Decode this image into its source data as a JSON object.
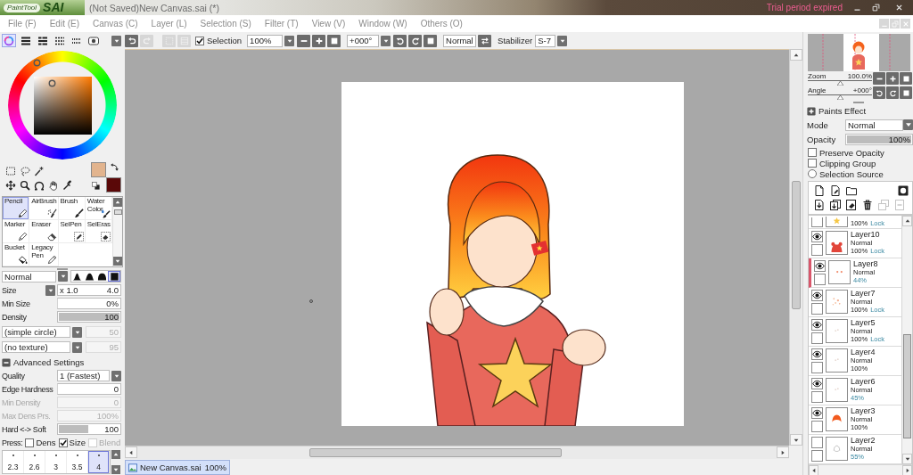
{
  "title_bar": {
    "logo_script": "PaintTool",
    "logo_mark": "SAI",
    "title": "(Not Saved)New Canvas.sai (*)",
    "notice": "Trial period expired"
  },
  "menu": [
    "File (F)",
    "Edit (E)",
    "Canvas (C)",
    "Layer (L)",
    "Selection (S)",
    "Filter (T)",
    "View (V)",
    "Window (W)",
    "Others (O)"
  ],
  "color_modes": [
    {
      "kind": "wheel",
      "selected": true
    },
    {
      "kind": "rgb",
      "selected": false
    },
    {
      "kind": "hsv",
      "selected": false
    },
    {
      "kind": "mixer",
      "selected": false
    },
    {
      "kind": "swatches",
      "selected": false
    },
    {
      "kind": "scratchpad",
      "selected": false
    }
  ],
  "colors": [
    {
      "kind": "primary",
      "color": "#e2b48e"
    },
    {
      "kind": "secondary",
      "color": "#5a0808"
    }
  ],
  "toolbar": {
    "buttons": [
      {
        "kind": "undo",
        "disabled": false
      },
      {
        "kind": "redo",
        "disabled": true
      },
      {
        "kind": "deselect",
        "disabled": true
      },
      {
        "kind": "invert",
        "disabled": true
      }
    ],
    "selection": {
      "label": "Selection",
      "checked": true
    },
    "zoom": "100%",
    "angle": "+000°",
    "blend": "Normal",
    "stabilizer": {
      "label": "Stabilizer",
      "value": "S-7"
    }
  },
  "tools": [
    {
      "kind": "pencil",
      "label": "Pencil",
      "selected": true
    },
    {
      "kind": "airbrush",
      "label": "AirBrush",
      "selected": false
    },
    {
      "kind": "brush",
      "label": "Brush",
      "selected": false
    },
    {
      "kind": "watercolor",
      "label": "Water Color",
      "selected": false
    },
    {
      "kind": "marker",
      "label": "Marker",
      "selected": false
    },
    {
      "kind": "eraser",
      "label": "Eraser",
      "selected": false
    },
    {
      "kind": "selpen",
      "label": "SelPen",
      "selected": false
    },
    {
      "kind": "seleras",
      "label": "SelEras",
      "selected": false
    },
    {
      "kind": "bucket",
      "label": "Bucket",
      "selected": false
    },
    {
      "kind": "legacypen",
      "label": "Legacy Pen",
      "selected": false
    }
  ],
  "brush": {
    "blend": "Normal",
    "shapes": [
      {
        "kind": "soft",
        "selected": false
      },
      {
        "kind": "medium",
        "selected": false
      },
      {
        "kind": "hard",
        "selected": false
      },
      {
        "kind": "square",
        "selected": true
      }
    ],
    "rows": [
      {
        "kind": "multiplier",
        "label": "Size",
        "factor": "x 1.0",
        "value": "4.0",
        "disabled": false
      },
      {
        "kind": "field",
        "label": "Min Size",
        "value": "0%",
        "disabled": false
      },
      {
        "kind": "bar",
        "label": "Density",
        "value": "100",
        "level": 1,
        "disabled": false
      },
      {
        "kind": "pair",
        "value": "(simple circle)",
        "amount": "50",
        "disabled": true
      },
      {
        "kind": "pair",
        "value": "(no texture)",
        "amount": "95",
        "disabled": true
      }
    ],
    "advanced": {
      "label": "Advanced Settings",
      "expanded": true,
      "rows": [
        {
          "kind": "dropdown",
          "label": "Quality",
          "value": "1 (Fastest)",
          "disabled": false
        },
        {
          "kind": "field",
          "label": "Edge Hardness",
          "value": "0",
          "disabled": false
        },
        {
          "kind": "field",
          "label": "Min Density",
          "value": "0",
          "disabled": true
        },
        {
          "kind": "field",
          "label": "Max Dens Prs.",
          "value": "100%",
          "disabled": true
        },
        {
          "kind": "bar",
          "label": "Hard <-> Soft",
          "value": "100",
          "level": 0.49,
          "disabled": false
        }
      ]
    },
    "pressure": {
      "label": "Press:",
      "options": [
        {
          "label": "Dens",
          "checked": false,
          "disabled": false
        },
        {
          "label": "Size",
          "checked": true,
          "disabled": false
        },
        {
          "label": "Blend",
          "checked": false,
          "disabled": true
        }
      ]
    },
    "presets": [
      {
        "value": "2.3",
        "selected": false
      },
      {
        "value": "2.6",
        "selected": false
      },
      {
        "value": "3",
        "selected": false
      },
      {
        "value": "3.5",
        "selected": false
      },
      {
        "value": "4",
        "selected": true
      }
    ]
  },
  "canvas_tabs": [
    {
      "label": "New Canvas.sai",
      "zoom": "100%",
      "selected": true
    }
  ],
  "navigator": {
    "zoom": {
      "label": "Zoom",
      "value": "100.0%",
      "level": 0.5
    },
    "angle": {
      "label": "Angle",
      "value": "+000°",
      "level": 0.5
    }
  },
  "paints_effect": {
    "label": "Paints Effect",
    "expanded": false
  },
  "layer_properties": {
    "mode": {
      "label": "Mode",
      "value": "Normal"
    },
    "opacity": {
      "label": "Opacity",
      "value": "100%",
      "level": 1
    },
    "options": [
      {
        "kind": "checkbox",
        "label": "Preserve Opacity",
        "checked": false
      },
      {
        "kind": "checkbox",
        "label": "Clipping Group",
        "checked": false
      },
      {
        "kind": "radio",
        "label": "Selection Source",
        "checked": false
      }
    ]
  },
  "layer_actions": {
    "top": [
      {
        "kind": "new-layer",
        "disabled": false
      },
      {
        "kind": "new-linework",
        "disabled": false
      },
      {
        "kind": "new-folder",
        "disabled": false
      },
      {
        "kind": "mask",
        "disabled": false
      }
    ],
    "bottom": [
      {
        "kind": "transfer-down",
        "disabled": false
      },
      {
        "kind": "merge-down",
        "disabled": false
      },
      {
        "kind": "clear",
        "disabled": false
      },
      {
        "kind": "delete",
        "disabled": false
      },
      {
        "kind": "copy",
        "disabled": true
      },
      {
        "kind": "remove-mask",
        "disabled": true
      }
    ]
  },
  "layers": [
    {
      "kind": "partial",
      "opacity": "100%",
      "lock": "Lock",
      "thumbnail": {
        "kind": "star"
      },
      "opacity_reduced": false,
      "selected": false
    },
    {
      "kind": "full",
      "name": "Layer10",
      "mode": "Normal",
      "opacity": "100%",
      "lock": "Lock",
      "thumbnail": {
        "kind": "body"
      },
      "visible": true,
      "opacity_reduced": false,
      "selected": false
    },
    {
      "kind": "full",
      "name": "Layer8",
      "mode": "Normal",
      "opacity": "44%",
      "thumbnail": {
        "kind": "blush"
      },
      "visible": true,
      "opacity_reduced": true,
      "selected": true
    },
    {
      "kind": "full",
      "name": "Layer7",
      "mode": "Normal",
      "opacity": "100%",
      "lock": "Lock",
      "thumbnail": {
        "kind": "sparkles"
      },
      "visible": true,
      "opacity_reduced": false,
      "selected": false
    },
    {
      "kind": "full",
      "name": "Layer5",
      "mode": "Normal",
      "opacity": "100%",
      "lock": "Lock",
      "thumbnail": {
        "kind": "dots"
      },
      "visible": true,
      "opacity_reduced": false,
      "selected": false
    },
    {
      "kind": "full",
      "name": "Layer4",
      "mode": "Normal",
      "opacity": "100%",
      "thumbnail": {
        "kind": "dots"
      },
      "visible": true,
      "opacity_reduced": false,
      "selected": false
    },
    {
      "kind": "full",
      "name": "Layer6",
      "mode": "Normal",
      "opacity": "45%",
      "thumbnail": {
        "kind": "dots"
      },
      "visible": true,
      "opacity_reduced": true,
      "selected": false
    },
    {
      "kind": "full",
      "name": "Layer3",
      "mode": "Normal",
      "opacity": "100%",
      "thumbnail": {
        "kind": "hair"
      },
      "visible": true,
      "opacity_reduced": false,
      "selected": false
    },
    {
      "kind": "full",
      "name": "Layer2",
      "mode": "Normal",
      "opacity": "55%",
      "thumbnail": {
        "kind": "sketch"
      },
      "visible": false,
      "opacity_reduced": true,
      "selected": false
    }
  ]
}
